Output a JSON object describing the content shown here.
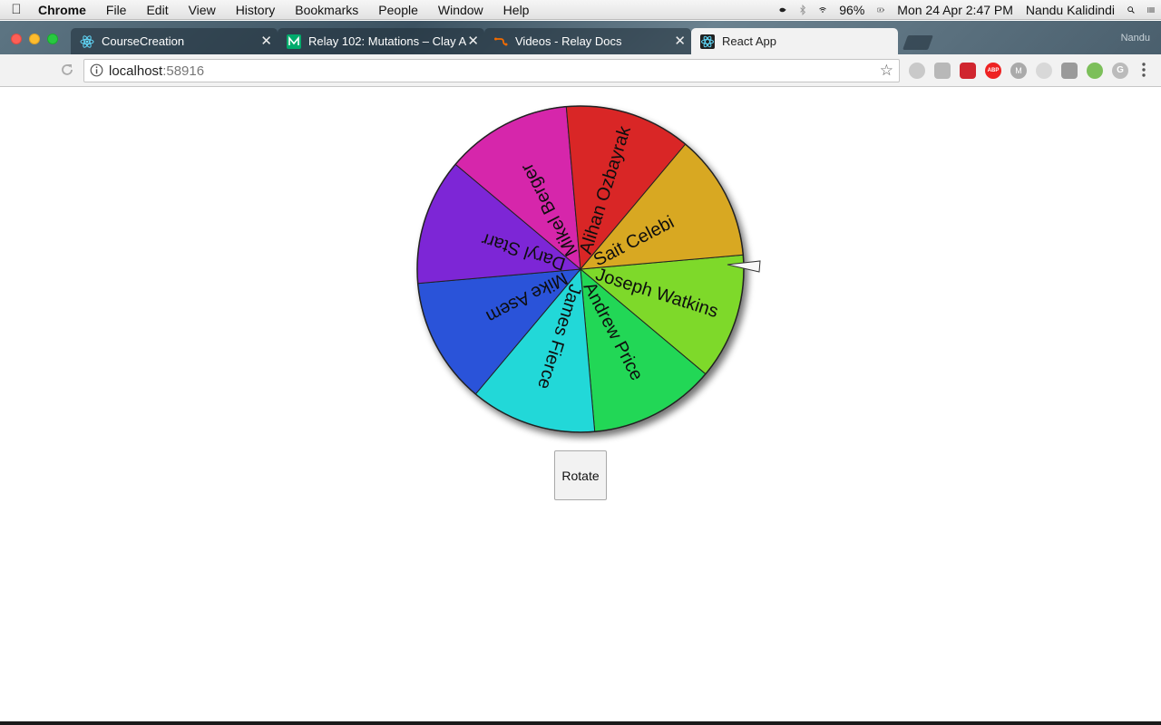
{
  "menubar": {
    "app_name": "Chrome",
    "items": [
      "File",
      "Edit",
      "View",
      "History",
      "Bookmarks",
      "People",
      "Window",
      "Help"
    ],
    "battery": "96%",
    "datetime": "Mon 24 Apr  2:47 PM",
    "user": "Nandu Kalidindi",
    "icons": [
      "apple-logo",
      "coffee-icon",
      "bluetooth-icon",
      "wifi-icon",
      "battery-icon",
      "search-icon",
      "notification-center-icon"
    ]
  },
  "browser": {
    "tabs": [
      {
        "title": "CourseCreation",
        "icon": "react-icon",
        "active": false
      },
      {
        "title": "Relay 102: Mutations – Clay A",
        "icon": "medium-icon",
        "active": false
      },
      {
        "title": "Videos - Relay Docs",
        "icon": "relay-icon",
        "active": false
      },
      {
        "title": "React App",
        "icon": "react-icon",
        "active": true
      }
    ],
    "profile_name": "Nandu",
    "address": {
      "host": "localhost",
      "port": ":58916"
    },
    "extension_icons": [
      "sync-icon",
      "reader-icon",
      "pocket-icon",
      "adblock-icon",
      "m-icon",
      "react-devtools-icon",
      "shield-icon",
      "tree-icon",
      "grammarly-icon",
      "menu-icon"
    ]
  },
  "wheel": {
    "segments": [
      {
        "name": "Joseph Watkins",
        "color": "#7ed92a"
      },
      {
        "name": "Andrew Price",
        "color": "#24d756"
      },
      {
        "name": "James Fierce",
        "color": "#23d8d8"
      },
      {
        "name": "Mike Asem",
        "color": "#2a52d9"
      },
      {
        "name": "Daryl Starr",
        "color": "#7d27d6"
      },
      {
        "name": "Mikel Berger",
        "color": "#d626ab"
      },
      {
        "name": "Alihan Ozbayrak",
        "color": "#d92728"
      },
      {
        "name": "Sait Celebi",
        "color": "#d8a824"
      }
    ],
    "rotate_label": "Rotate"
  }
}
